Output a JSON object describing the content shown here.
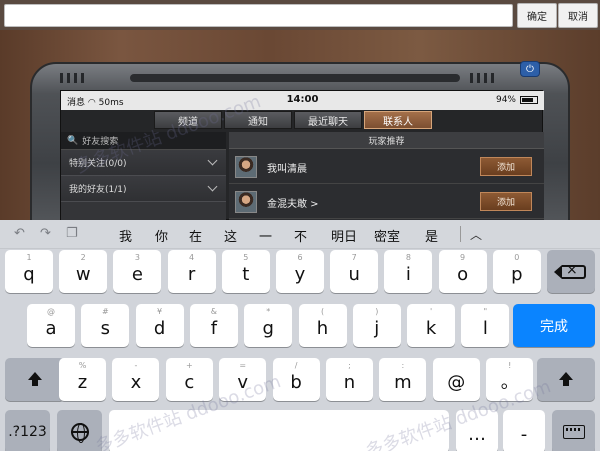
{
  "top_bar": {
    "input_value": "",
    "confirm_label": "确定",
    "cancel_label": "取消"
  },
  "game": {
    "status": {
      "carrier": "消息",
      "network": "50ms",
      "time": "14:00",
      "battery": "94%"
    },
    "tabs": [
      {
        "label": "频道",
        "active": false
      },
      {
        "label": "通知",
        "active": false
      },
      {
        "label": "最近聊天",
        "active": false
      },
      {
        "label": "联系人",
        "active": true
      }
    ],
    "friend_search_placeholder": "好友搜索",
    "groups": [
      {
        "label": "特别关注(0/0)"
      },
      {
        "label": "我的好友(1/1)"
      }
    ],
    "recommend_title": "玩家推荐",
    "players": [
      {
        "name": "我叫清晨",
        "add_label": "添加"
      },
      {
        "name": "金混夫敢 >",
        "add_label": "添加"
      }
    ]
  },
  "keyboard": {
    "suggestions": [
      "我",
      "你",
      "在",
      "这",
      "一",
      "不",
      "明日",
      "密室",
      "是"
    ],
    "row1": [
      {
        "main": "q",
        "alt": "1"
      },
      {
        "main": "w",
        "alt": "2"
      },
      {
        "main": "e",
        "alt": "3"
      },
      {
        "main": "r",
        "alt": "4"
      },
      {
        "main": "t",
        "alt": "5"
      },
      {
        "main": "y",
        "alt": "6"
      },
      {
        "main": "u",
        "alt": "7"
      },
      {
        "main": "i",
        "alt": "8"
      },
      {
        "main": "o",
        "alt": "9"
      },
      {
        "main": "p",
        "alt": "0"
      }
    ],
    "row2": [
      {
        "main": "a",
        "alt": "@"
      },
      {
        "main": "s",
        "alt": "#"
      },
      {
        "main": "d",
        "alt": "¥"
      },
      {
        "main": "f",
        "alt": "&"
      },
      {
        "main": "g",
        "alt": "*"
      },
      {
        "main": "h",
        "alt": "("
      },
      {
        "main": "j",
        "alt": ")"
      },
      {
        "main": "k",
        "alt": "'"
      },
      {
        "main": "l",
        "alt": "\""
      }
    ],
    "row3": [
      {
        "main": "z",
        "alt": "%"
      },
      {
        "main": "x",
        "alt": "-"
      },
      {
        "main": "c",
        "alt": "+"
      },
      {
        "main": "v",
        "alt": "="
      },
      {
        "main": "b",
        "alt": "/"
      },
      {
        "main": "n",
        "alt": ";"
      },
      {
        "main": "m",
        "alt": ":"
      },
      {
        "main": "@",
        "alt": ""
      },
      {
        "main": "。",
        "alt": "!"
      }
    ],
    "done_label": "完成",
    "numbers_label": ".?123",
    "bottom_punct": [
      {
        "main": "…",
        "alt": ""
      },
      {
        "main": "-",
        "alt": ""
      }
    ]
  },
  "watermark": "多多软件站 ddooo.com",
  "colors": {
    "done_key": "#0a84ff",
    "tab_active": "#a4704a",
    "add_button": "#8d5a34"
  }
}
